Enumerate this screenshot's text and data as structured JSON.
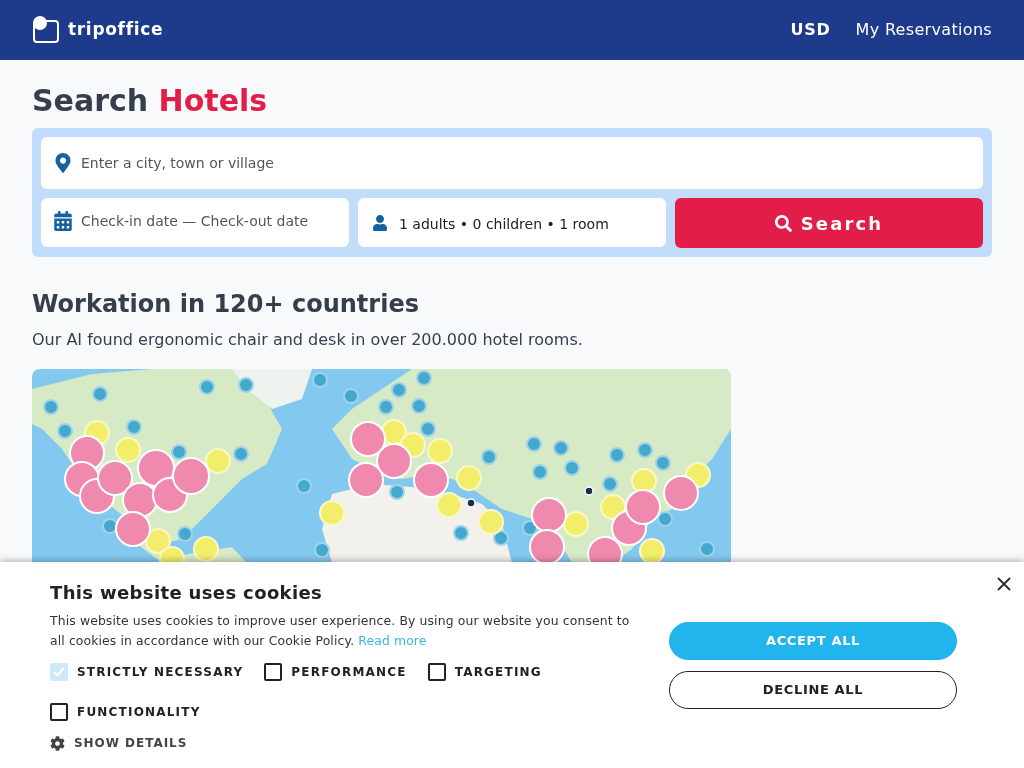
{
  "header": {
    "logo": "tripoffice",
    "currency": "USD",
    "nav_link": "My Reservations"
  },
  "search": {
    "title": "Search",
    "title_highlight": "Hotels",
    "destination": {
      "placeholder": "Enter a city, town or village"
    },
    "dates": {
      "placeholder": "Check-in date — Check-out date"
    },
    "guests": {
      "value": "1 adults • 0 children • 1 room"
    },
    "button": "Search"
  },
  "promo": {
    "title": "Workation in 120+ countries",
    "subtitle": "Our AI found ergonomic chair and desk in over 200.000 hotel rooms."
  },
  "cookie_banner": {
    "title": "This website uses cookies",
    "text": "This website uses cookies to improve user experience. By using our website you consent to all cookies in accordance with our Cookie Policy.",
    "link": "Read more",
    "options": [
      {
        "label": "STRICTLY NECESSARY",
        "checked": true,
        "disabled": true
      },
      {
        "label": "PERFORMANCE",
        "checked": false,
        "disabled": false
      },
      {
        "label": "TARGETING",
        "checked": false,
        "disabled": false
      },
      {
        "label": "FUNCTIONALITY",
        "checked": false,
        "disabled": false
      }
    ],
    "details": "SHOW DETAILS",
    "buttons": [
      {
        "label": "ACCEPT ALL",
        "kind": "primary"
      },
      {
        "label": "DECLINE ALL",
        "kind": "outline"
      }
    ]
  }
}
